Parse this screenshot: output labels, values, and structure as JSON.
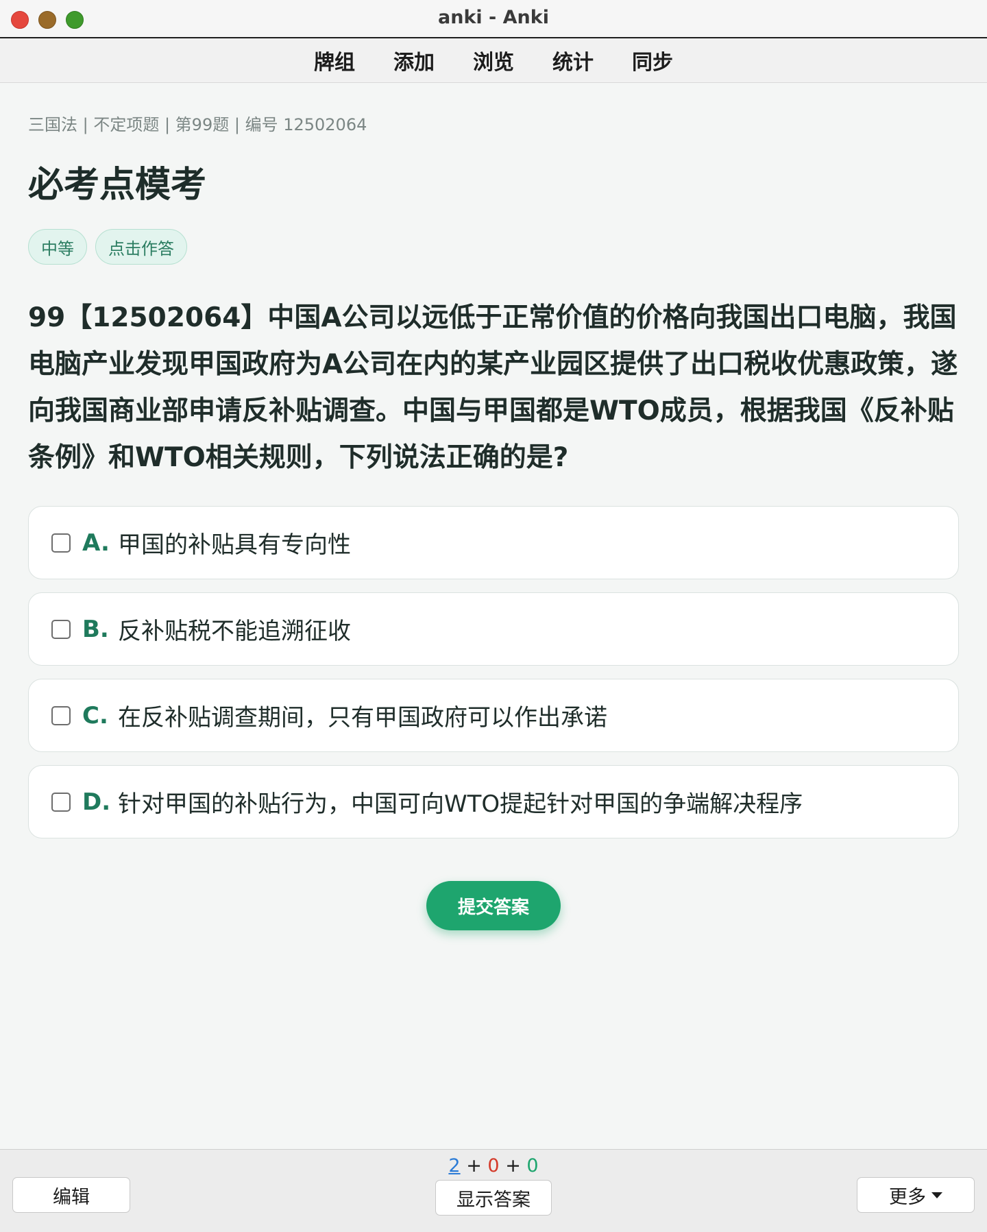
{
  "window": {
    "title": "anki - Anki"
  },
  "toolbar": {
    "items": [
      "牌组",
      "添加",
      "浏览",
      "统计",
      "同步"
    ]
  },
  "card": {
    "breadcrumb": "三国法 | 不定项题 | 第99题 | 编号 12502064",
    "title": "必考点模考",
    "tags": [
      "中等",
      "点击作答"
    ],
    "question": "99【12502064】中国A公司以远低于正常价值的价格向我国出口电脑，我国电脑产业发现甲国政府为A公司在内的某产业园区提供了出口税收优惠政策，遂向我国商业部申请反补贴调查。中国与甲国都是WTO成员，根据我国《反补贴条例》和WTO相关规则，下列说法正确的是?",
    "options": [
      {
        "letter": "A.",
        "text": "甲国的补贴具有专向性"
      },
      {
        "letter": "B.",
        "text": "反补贴税不能追溯征收"
      },
      {
        "letter": "C.",
        "text": "在反补贴调查期间，只有甲国政府可以作出承诺"
      },
      {
        "letter": "D.",
        "text": "针对甲国的补贴行为，中国可向WTO提起针对甲国的争端解决程序"
      }
    ],
    "submit_label": "提交答案"
  },
  "bottombar": {
    "edit_label": "编辑",
    "show_answer_label": "显示答案",
    "more_label": "更多",
    "counts": {
      "new": "2",
      "learn": "0",
      "review": "0",
      "plus": "+"
    }
  },
  "colors": {
    "accent": "#1ea56e",
    "new": "#2b7bd6",
    "learn": "#d43a2a",
    "review": "#1ea56e"
  }
}
